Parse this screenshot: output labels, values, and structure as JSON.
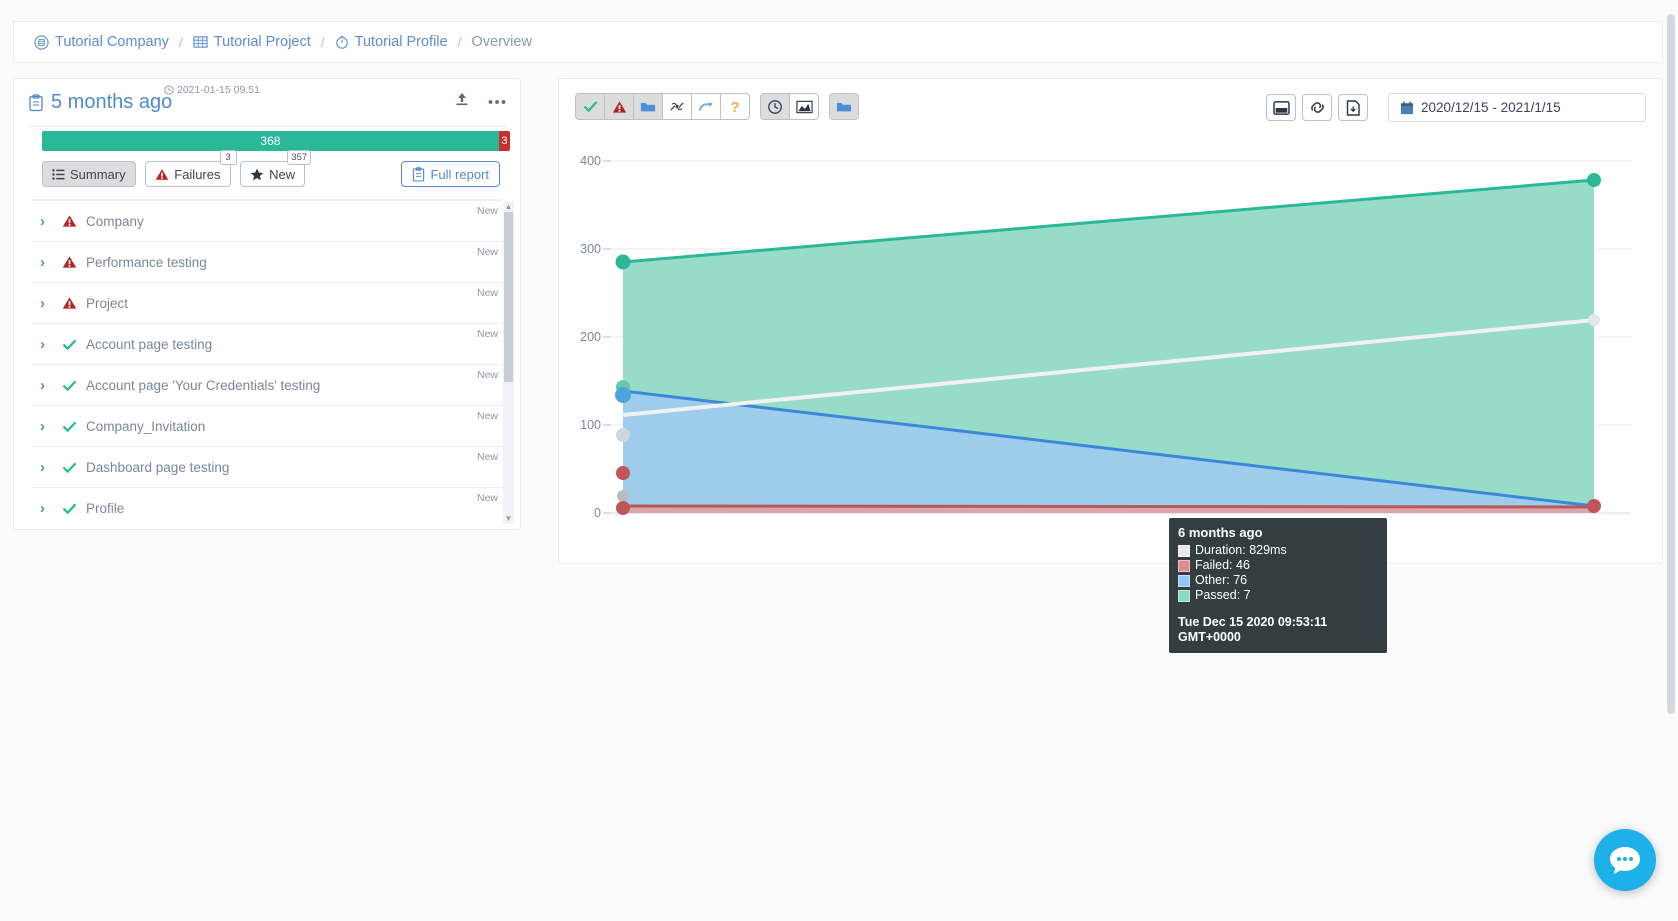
{
  "breadcrumb": {
    "items": [
      {
        "label": "Tutorial Company",
        "icon": "company-icon",
        "current": false
      },
      {
        "label": "Tutorial Project",
        "icon": "grid-icon",
        "current": false
      },
      {
        "label": "Tutorial Profile",
        "icon": "clock-icon",
        "current": false
      },
      {
        "label": "Overview",
        "icon": "",
        "current": true
      }
    ],
    "separator": "/"
  },
  "left_panel": {
    "title": "5 months ago",
    "timestamp": "2021-01-15 09:51",
    "actions": {
      "upload": "upload-icon",
      "more": "more-icon"
    },
    "progress": {
      "passed": 368,
      "failed": 3,
      "passed_label": "368",
      "failed_label": "3",
      "passed_color": "#2bb899",
      "failed_color": "#c9302c"
    },
    "tabs": [
      {
        "label": "Summary",
        "icon": "list-icon",
        "badge": "",
        "active": true
      },
      {
        "label": "Failures",
        "icon": "warning-icon",
        "badge": "3",
        "active": false
      },
      {
        "label": "New",
        "icon": "star-icon",
        "badge": "357",
        "active": false
      }
    ],
    "full_report_label": "Full report",
    "tag_new": "New",
    "tests": [
      {
        "name": "Company",
        "status": "failed"
      },
      {
        "name": "Performance testing",
        "status": "failed"
      },
      {
        "name": "Project",
        "status": "failed"
      },
      {
        "name": "Account page testing",
        "status": "passed"
      },
      {
        "name": "Account page 'Your Credentials' testing",
        "status": "passed"
      },
      {
        "name": "Company_Invitation",
        "status": "passed"
      },
      {
        "name": "Dashboard page testing",
        "status": "passed"
      },
      {
        "name": "Profile",
        "status": "passed"
      }
    ]
  },
  "right_panel": {
    "toolbar_left": [
      {
        "name": "filter-passed-button",
        "icon": "check-icon",
        "active": true
      },
      {
        "name": "filter-failed-button",
        "icon": "warning-icon",
        "active": true
      },
      {
        "name": "filter-other-button",
        "icon": "folder-icon",
        "active": true
      },
      {
        "name": "filter-broken-button",
        "icon": "broken-link-icon",
        "active": false
      },
      {
        "name": "filter-rerun-button",
        "icon": "redo-icon",
        "active": false
      },
      {
        "name": "filter-unknown-button",
        "icon": "question-icon",
        "active": false
      }
    ],
    "toolbar_mid": [
      {
        "name": "duration-button",
        "icon": "clock-icon",
        "active": true
      },
      {
        "name": "chart-type-button",
        "icon": "area-chart-icon",
        "active": false
      }
    ],
    "toolbar_folder": [
      {
        "name": "folder-filter-button",
        "icon": "folder-icon",
        "active": true
      }
    ],
    "toolbar_right": [
      {
        "name": "fullscreen-button",
        "icon": "window-icon"
      },
      {
        "name": "link-button",
        "icon": "link-icon"
      },
      {
        "name": "export-button",
        "icon": "export-icon"
      }
    ],
    "date_range": {
      "icon": "calendar-icon",
      "value": "2020/12/15 - 2021/1/15"
    }
  },
  "tooltip": {
    "title": "6 months ago",
    "rows": [
      {
        "label": "Duration: 829ms",
        "color": "#e8e8e8"
      },
      {
        "label": "Failed: 46",
        "color": "#d9868a"
      },
      {
        "label": "Other: 76",
        "color": "#8cc3ef"
      },
      {
        "label": "Passed: 7",
        "color": "#7fd9bd"
      }
    ],
    "time": "Tue Dec 15 2020 09:53:11 GMT+0000"
  },
  "chart_data": {
    "type": "area",
    "title": "",
    "xlabel": "",
    "ylabel": "",
    "ylim": [
      0,
      400
    ],
    "yticks": [
      0,
      100,
      200,
      300,
      400
    ],
    "grid": true,
    "legend_position": "none",
    "x": [
      "2020-12-15",
      "2021-01-15"
    ],
    "x_labels": [
      "6 months ago",
      "5 months ago"
    ],
    "series": [
      {
        "name": "Passed",
        "color": "#2bb899",
        "fill": "#85d6bf",
        "values": [
          285,
          371
        ]
      },
      {
        "name": "Other",
        "color": "#3b87d8",
        "fill": "#9ecbee",
        "values": [
          138,
          8
        ]
      },
      {
        "name": "Failed",
        "color": "#b5595c",
        "fill": "#dda3a5",
        "values": [
          8,
          7
        ]
      },
      {
        "name": "Duration",
        "color": "#eeeeee",
        "fill": "none",
        "values": [
          112,
          222
        ]
      }
    ],
    "point_values": {
      "left": {
        "Passed": 285,
        "Other": 138,
        "Failed": 8,
        "Duration": 112
      },
      "right": {
        "Passed": 371,
        "Other": 8,
        "Failed": 7,
        "Duration": 222
      }
    }
  }
}
